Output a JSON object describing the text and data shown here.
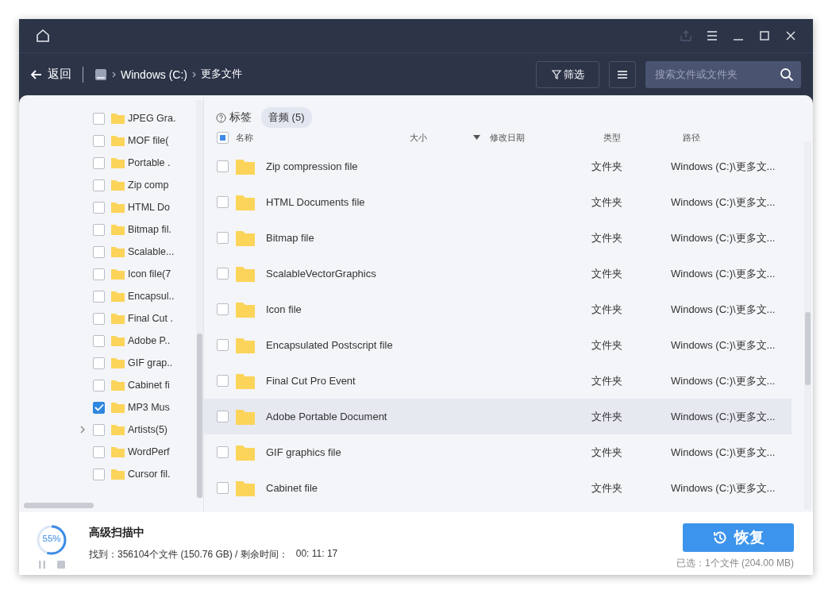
{
  "window": {
    "share_disabled": true
  },
  "nav": {
    "back": "返回",
    "breadcrumb": [
      "Windows (C:)",
      "更多文件"
    ],
    "filter": "筛选",
    "search": {
      "placeholder": "搜索文件或文件夹"
    }
  },
  "tree": [
    {
      "label": "JPEG Gra.",
      "kind": "leaf",
      "checked": false
    },
    {
      "label": "MOF file(",
      "kind": "leaf",
      "checked": false
    },
    {
      "label": "Portable .",
      "kind": "leaf",
      "checked": false
    },
    {
      "label": "Zip comp",
      "kind": "leaf",
      "checked": false
    },
    {
      "label": "HTML Do",
      "kind": "leaf",
      "checked": false
    },
    {
      "label": "Bitmap fil.",
      "kind": "leaf",
      "checked": false
    },
    {
      "label": "Scalable...",
      "kind": "leaf",
      "checked": false
    },
    {
      "label": "Icon file(7",
      "kind": "leaf",
      "checked": false
    },
    {
      "label": "Encapsul..",
      "kind": "leaf",
      "checked": false
    },
    {
      "label": "Final Cut .",
      "kind": "leaf",
      "checked": false
    },
    {
      "label": "Adobe P..",
      "kind": "leaf",
      "checked": false
    },
    {
      "label": "GIF grap..",
      "kind": "leaf",
      "checked": false
    },
    {
      "label": "Cabinet fi",
      "kind": "leaf",
      "checked": false
    },
    {
      "label": "MP3 Mus",
      "kind": "leaf",
      "checked": true
    },
    {
      "label": "Artists(5)",
      "kind": "expandable",
      "checked": false
    },
    {
      "label": "WordPerf",
      "kind": "leaf",
      "checked": false
    },
    {
      "label": "Cursor fil.",
      "kind": "leaf",
      "checked": false
    }
  ],
  "tags": {
    "label": "标签",
    "chips": [
      "音频 (5)"
    ]
  },
  "table": {
    "select_all_partial": true,
    "columns": [
      "名称",
      "大小",
      "修改日期",
      "类型",
      "路径"
    ],
    "rows": [
      {
        "name": "Zip compression file",
        "type": "文件夹",
        "path": "Windows (C:)\\更多文...",
        "checked": false,
        "selected": false
      },
      {
        "name": "HTML Documents file",
        "type": "文件夹",
        "path": "Windows (C:)\\更多文...",
        "checked": false,
        "selected": false
      },
      {
        "name": "Bitmap file",
        "type": "文件夹",
        "path": "Windows (C:)\\更多文...",
        "checked": false,
        "selected": false
      },
      {
        "name": "ScalableVectorGraphics",
        "type": "文件夹",
        "path": "Windows (C:)\\更多文...",
        "checked": false,
        "selected": false
      },
      {
        "name": "Icon file",
        "type": "文件夹",
        "path": "Windows (C:)\\更多文...",
        "checked": false,
        "selected": false
      },
      {
        "name": "Encapsulated Postscript file",
        "type": "文件夹",
        "path": "Windows (C:)\\更多文...",
        "checked": false,
        "selected": false
      },
      {
        "name": "Final Cut Pro Event",
        "type": "文件夹",
        "path": "Windows (C:)\\更多文...",
        "checked": false,
        "selected": false
      },
      {
        "name": "Adobe Portable Document",
        "type": "文件夹",
        "path": "Windows (C:)\\更多文...",
        "checked": false,
        "selected": true
      },
      {
        "name": "GIF graphics file",
        "type": "文件夹",
        "path": "Windows (C:)\\更多文...",
        "checked": false,
        "selected": false
      },
      {
        "name": "Cabinet file",
        "type": "文件夹",
        "path": "Windows (C:)\\更多文...",
        "checked": false,
        "selected": false
      }
    ]
  },
  "status": {
    "progress": {
      "level": 0.55,
      "reading": "55%"
    },
    "title": "高级扫描中",
    "found": "找到：356104个文件 (150.76 GB) / 剩余时间：",
    "time": "00: 11: 17",
    "selection": "已选：1个文件 (204.00 MB)",
    "recover": "恢复"
  }
}
